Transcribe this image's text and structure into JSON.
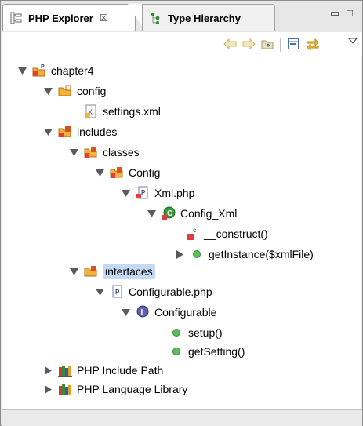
{
  "tabs": [
    {
      "label": "PHP Explorer",
      "close": "☒"
    },
    {
      "label": "Type Hierarchy"
    }
  ],
  "window_controls": {
    "minimize": "▭",
    "maximize": "□"
  },
  "tree": [
    {
      "label": "chapter4"
    },
    {
      "label": "config"
    },
    {
      "label": "settings.xml"
    },
    {
      "label": "includes"
    },
    {
      "label": "classes"
    },
    {
      "label": "Config"
    },
    {
      "label": "Xml.php"
    },
    {
      "label": "Config_Xml"
    },
    {
      "label": "__construct()"
    },
    {
      "label": "getInstance($xmlFile)"
    },
    {
      "label": "interfaces"
    },
    {
      "label": "Configurable.php"
    },
    {
      "label": "Configurable"
    },
    {
      "label": "setup()"
    },
    {
      "label": "getSetting()"
    },
    {
      "label": "PHP Include Path"
    },
    {
      "label": "PHP Language Library"
    }
  ],
  "colors": {
    "selection": "#c5d9f5",
    "method_green": "#4caf50",
    "folder_orange": "#f0a030"
  }
}
